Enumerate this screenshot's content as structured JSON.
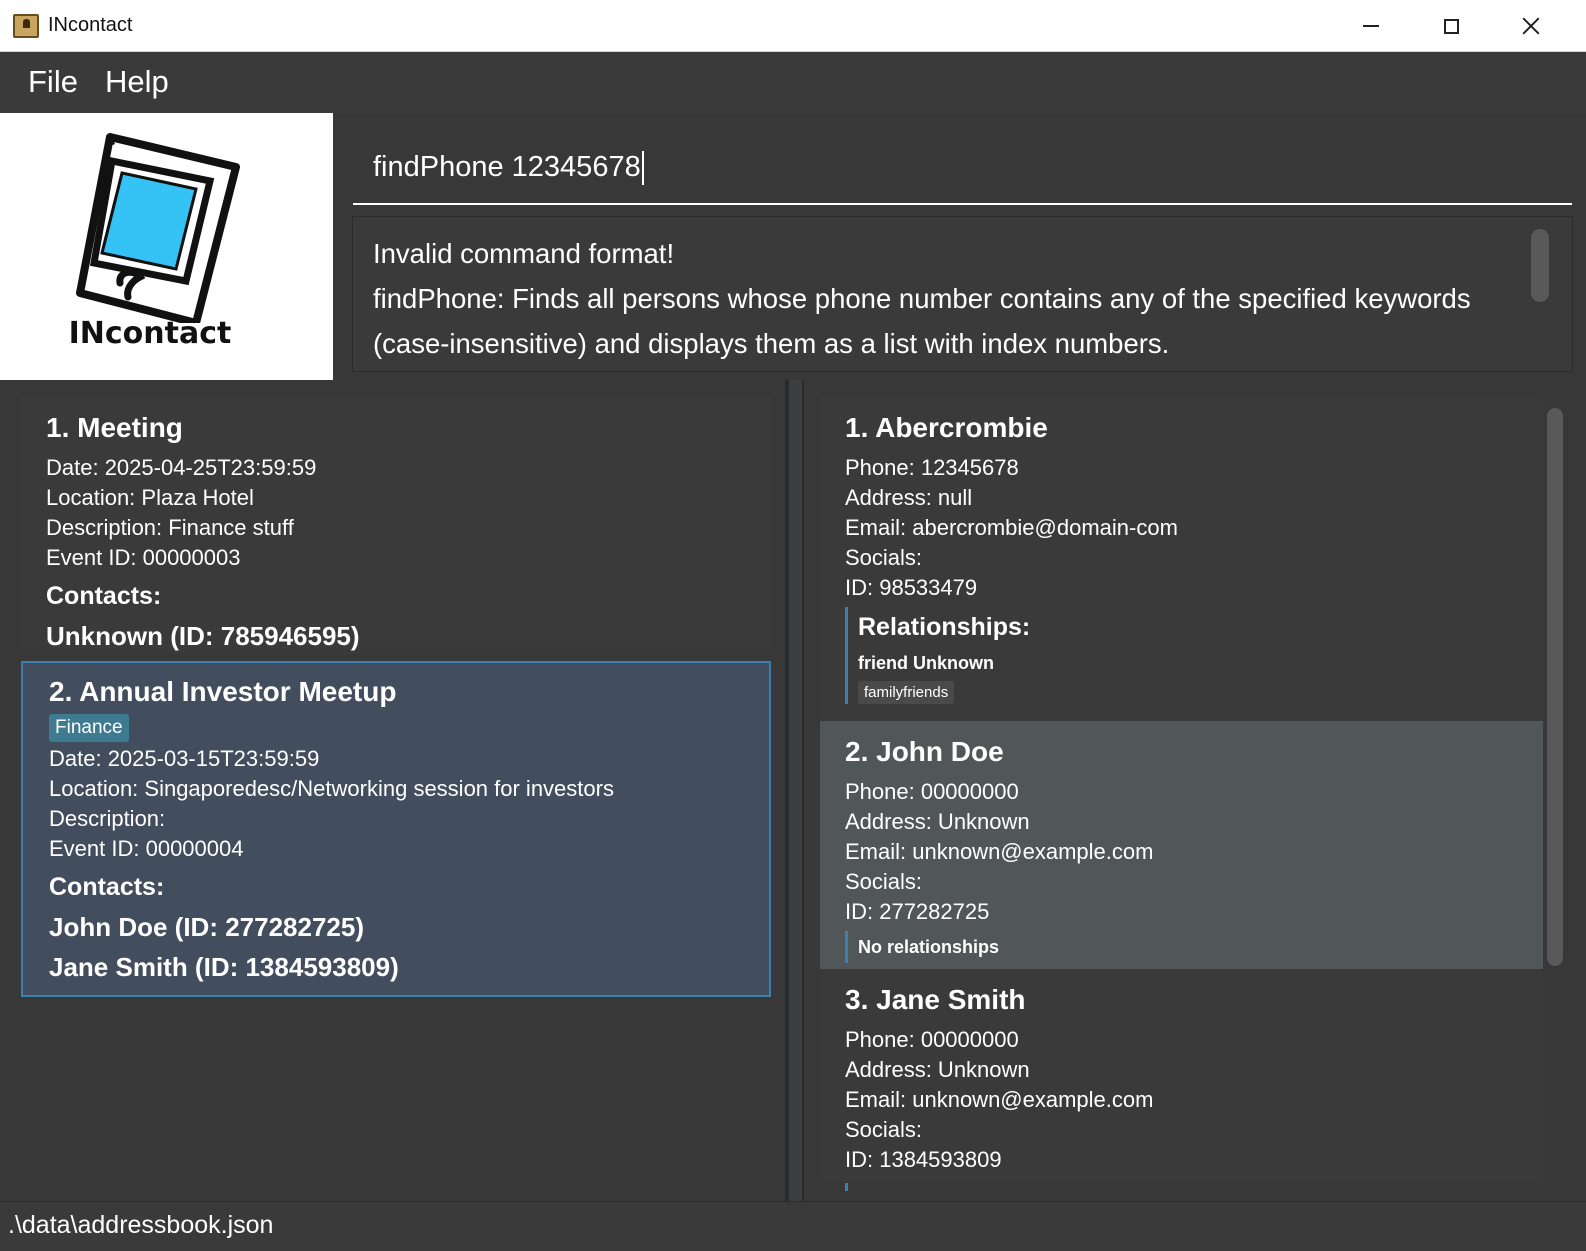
{
  "window": {
    "title": "INcontact"
  },
  "menu": {
    "file": "File",
    "help": "Help"
  },
  "logo": {
    "text": "INcontact"
  },
  "command": {
    "value": "findPhone 12345678"
  },
  "result": {
    "line1": "Invalid command format!",
    "line2": "findPhone: Finds all persons whose phone number contains any of the specified keywords (case-insensitive) and displays them as a list with index numbers."
  },
  "events": [
    {
      "title": "1.  Meeting",
      "tag": "",
      "date": "Date: 2025-04-25T23:59:59",
      "location": "Location: Plaza Hotel",
      "description": "Description: Finance stuff",
      "event_id": "Event ID: 00000003",
      "contacts_heading": "Contacts:",
      "contacts": [
        "Unknown (ID: 785946595)"
      ]
    },
    {
      "title": "2.  Annual Investor Meetup",
      "tag": "Finance",
      "date": "Date: 2025-03-15T23:59:59",
      "location": "Location: Singaporedesc/Networking session for investors",
      "description": "Description:",
      "event_id": "Event ID: 00000004",
      "contacts_heading": "Contacts:",
      "contacts": [
        "John Doe (ID: 277282725)",
        "Jane Smith (ID: 1384593809)"
      ]
    }
  ],
  "persons": [
    {
      "name": "1. Abercrombie",
      "phone": "Phone: 12345678",
      "address": "Address: null",
      "email": "Email: abercrombie@domain-com",
      "socials": "Socials:",
      "id": "ID: 98533479",
      "relationships_heading": "Relationships:",
      "relationship": "friend  Unknown",
      "relationship_tag": "familyfriends"
    },
    {
      "name": "2. John Doe",
      "phone": "Phone: 00000000",
      "address": "Address: Unknown",
      "email": "Email: unknown@example.com",
      "socials": "Socials:",
      "id": "ID: 277282725",
      "no_relationships": "No relationships"
    },
    {
      "name": "3. Jane Smith",
      "phone": "Phone: 00000000",
      "address": "Address: Unknown",
      "email": "Email: unknown@example.com",
      "socials": "Socials:",
      "id": "ID: 1384593809"
    }
  ],
  "status": {
    "path": ".\\data\\addressbook.json"
  },
  "colors": {
    "background": "#3c3f41",
    "selected_card": "#424d5e",
    "selected_border": "#3c7fb1",
    "tag": "#3e7b91",
    "accent": "#3c7fb1"
  }
}
